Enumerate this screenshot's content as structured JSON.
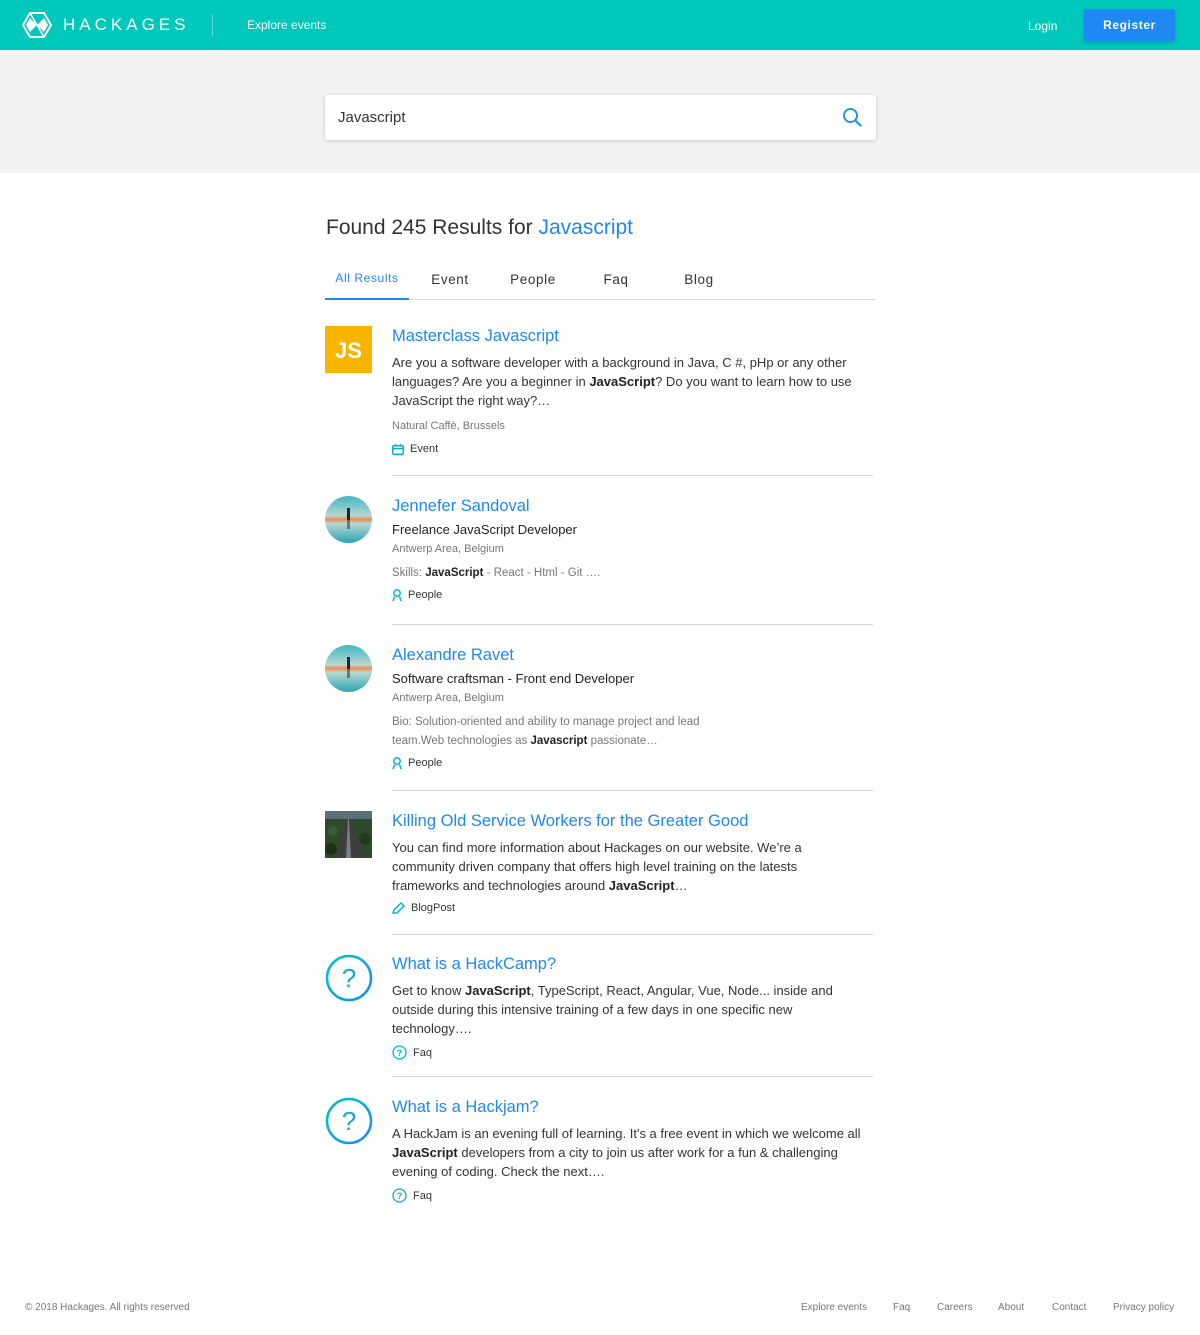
{
  "header": {
    "brand": "HACKAGES",
    "nav_explore": "Explore events",
    "login": "Login",
    "register": "Register",
    "background_color": "#00c9bc",
    "register_color": "#1e88f5"
  },
  "search": {
    "value": "Javascript",
    "icon": "search-icon"
  },
  "results_header": {
    "prefix": "Found 245 Results for",
    "query": "Javascript"
  },
  "tabs": [
    {
      "label": "All Results",
      "active": true
    },
    {
      "label": "Event"
    },
    {
      "label": "People"
    },
    {
      "label": "Faq"
    },
    {
      "label": "Blog"
    }
  ],
  "results": [
    {
      "title": "Masterclass Javascript",
      "thumb_text": "JS",
      "desc_1": "Are you a software developer with a background in Java, C #, pHp or any other languages? Are you a beginner in ",
      "desc_bold": "JavaScript",
      "desc_2": "? Do you want to learn how to use JavaScript the right way?…",
      "location": "Natural Caffè, Brussels",
      "tag": "Event",
      "tag_icon": "calendar-icon"
    },
    {
      "title": "Jennefer Sandoval",
      "sub_1": "Freelance ",
      "sub_bold": "JavaScript",
      "sub_2": " Developer",
      "location": "Antwerp Area, Belgium",
      "skills_label": "Skills: ",
      "skills_bold": "JavaScript",
      "skills_rest": " - React - Html - Git ….",
      "tag": "People",
      "tag_icon": "person-icon"
    },
    {
      "title": "Alexandre Ravet",
      "subtitle": "Software craftsman - Front end Developer",
      "location": "Antwerp Area, Belgium",
      "bio_1": "Bio: Solution-oriented and ability to manage project and lead team.Web technologies as ",
      "bio_bold": "Javascript",
      "bio_2": " passionate…",
      "tag": "People",
      "tag_icon": "person-icon"
    },
    {
      "title": "Killing Old Service Workers for the Greater Good",
      "desc_1": "You can find more information about Hackages on our website. We’re a community driven company that offers high level training on the latests frameworks and technologies around ",
      "desc_bold": "JavaScript",
      "desc_2": "…",
      "tag": "BlogPost",
      "tag_icon": "pencil-icon"
    },
    {
      "title": "What is a HackCamp?",
      "desc_1": "Get to know ",
      "desc_bold": "JavaScript",
      "desc_2": ", TypeScript, React, Angular, Vue, Node... inside and outside during this intensive training of a few days in one specific new technology….",
      "tag": "Faq",
      "tag_icon": "question-icon"
    },
    {
      "title": "What is a Hackjam?",
      "desc_1": "A HackJam is an evening full of learning. It's a free event in which we welcome all ",
      "desc_bold": "JavaScript",
      "desc_2": " developers from a city to join us after work for a fun & challenging evening of coding. Check the next….",
      "tag": "Faq",
      "tag_icon": "question-icon"
    }
  ],
  "footer": {
    "copyright": "© 2018 Hackages. All rights reserved",
    "links": [
      "Explore events",
      "Faq",
      "Careers",
      "About",
      "Contact",
      "Privacy policy"
    ]
  }
}
